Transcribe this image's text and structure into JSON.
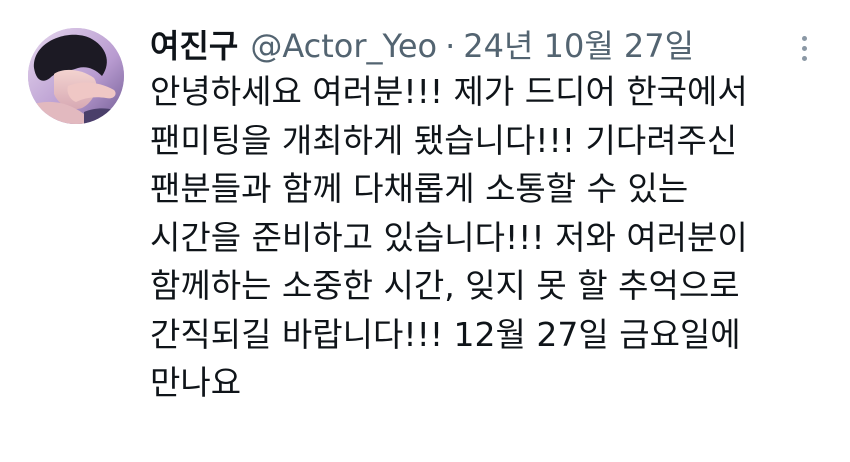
{
  "tweet": {
    "author": {
      "display_name": "여진구",
      "handle": "@Actor_Yeo",
      "avatar_icon": "profile-photo"
    },
    "separator": "·",
    "date": "24년 10월 27일",
    "more_icon": "vertical-ellipsis-icon",
    "text_lines": [
      "안녕하세요 여러분!!! 제가 드디어 한국에서",
      "팬미팅을 개최하게 됐습니다!!! 기다려주신",
      "팬분들과 함께 다채롭게 소통할 수 있는",
      "시간을 준비하고 있습니다!!! 저와 여러분이",
      "함께하는 소중한 시간, 잊지 못 할 추억으로",
      "간직되길 바랍니다!!! 12월 27일 금요일에",
      "만나요"
    ]
  },
  "colors": {
    "text_primary": "#0f1419",
    "text_secondary": "#536471",
    "icon_gray": "#8b98a5",
    "background": "#ffffff"
  }
}
